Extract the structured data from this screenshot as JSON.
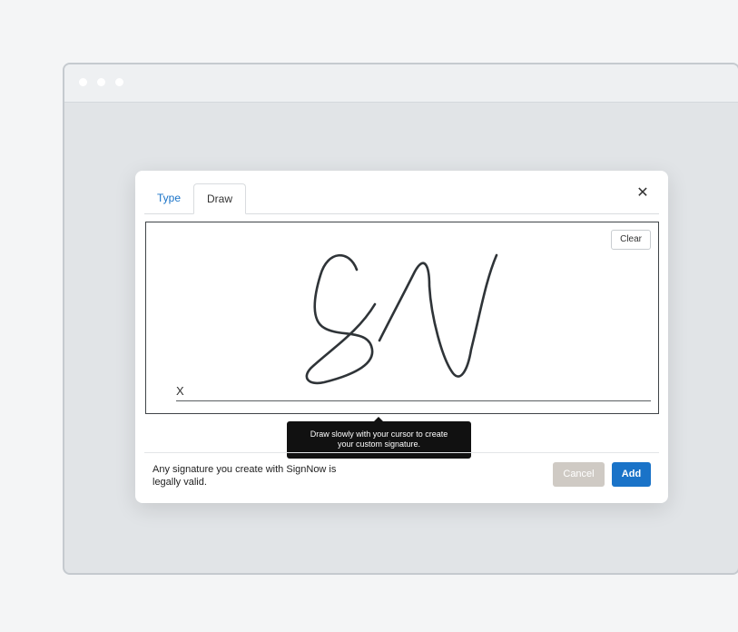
{
  "browser": {
    "window_dots": 3
  },
  "dialog": {
    "tabs": [
      {
        "label": "Type",
        "active": false
      },
      {
        "label": "Draw",
        "active": true
      }
    ],
    "close_icon": "close-icon",
    "canvas": {
      "clear_label": "Clear",
      "signature_mark": "X",
      "signature_drawing": "SN"
    },
    "tooltip": {
      "line1": "Draw slowly with your cursor to create",
      "line2": "your custom signature."
    },
    "footer": {
      "legal_line1": "Any signature you create with SignNow is",
      "legal_line2": "legally valid.",
      "cancel_label": "Cancel",
      "add_label": "Add"
    }
  },
  "colors": {
    "accent": "#1a73c8",
    "cancel_disabled": "#cfcac4",
    "tooltip_bg": "#111111",
    "ink": "#2f3438"
  }
}
